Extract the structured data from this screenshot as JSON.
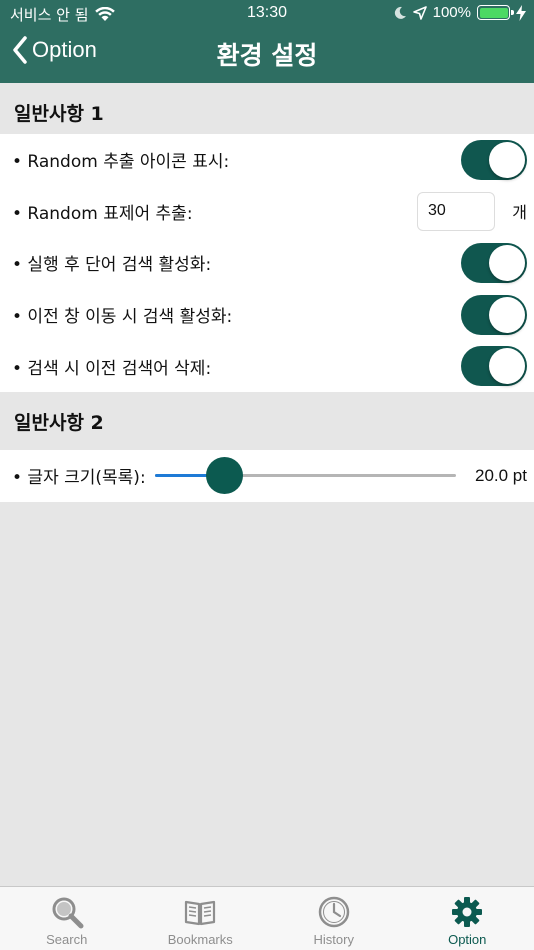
{
  "status_bar": {
    "carrier": "서비스 안 됨",
    "time": "13:30",
    "battery_percent": "100%",
    "battery_level": 1.0
  },
  "nav": {
    "back_label": "Option",
    "title": "환경 설정"
  },
  "section1": {
    "title": "일반사항 1",
    "rows": [
      {
        "label": "• Random 추출 아이콘 표시:",
        "toggle_on": true
      },
      {
        "label": "• Random 표제어 추출:",
        "input_value": "30",
        "unit": "개"
      },
      {
        "label": "• 실행 후 단어 검색 활성화:",
        "toggle_on": true
      },
      {
        "label": "• 이전 창 이동 시 검색 활성화:",
        "toggle_on": true
      },
      {
        "label": "• 검색 시 이전 검색어 삭제:",
        "toggle_on": true
      }
    ]
  },
  "section2": {
    "title": "일반사항 2",
    "font_size": {
      "label": "• 글자 크기(목록):",
      "value_text": "20.0 pt",
      "slider_fraction": 0.23
    }
  },
  "colors": {
    "header": "#2e6e62",
    "toggle_on": "#10574f",
    "accent": "#0c5a50",
    "slider_fill": "#1e7ad6"
  },
  "tab_bar": {
    "tabs": [
      {
        "label": "Search",
        "icon": "search-icon",
        "active": false
      },
      {
        "label": "Bookmarks",
        "icon": "book-icon",
        "active": false
      },
      {
        "label": "History",
        "icon": "clock-icon",
        "active": false
      },
      {
        "label": "Option",
        "icon": "gear-icon",
        "active": true
      }
    ]
  }
}
